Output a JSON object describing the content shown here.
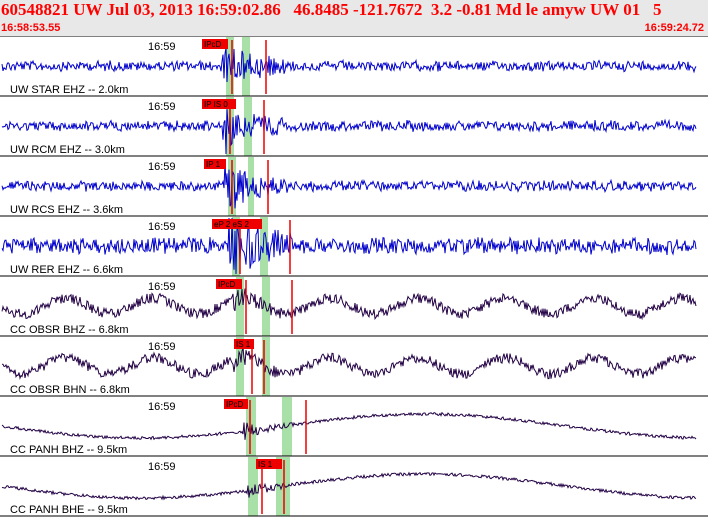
{
  "header": {
    "title": "60548821 UW Jul 03, 2013 16:59:02.86   46.8485 -121.7672  3.2 -0.81 Md le amyw UW 01   5",
    "start_time": "16:58:53.55",
    "end_time": "16:59:24.72"
  },
  "colors": {
    "header_text": "#ff0000",
    "header_bg": "#e8e8e8",
    "short_period_trace": "#0000cc",
    "broadband_trace": "#220044",
    "pick_band": "#a8e0a8",
    "pick_marker": "#ee0000"
  },
  "tracks": [
    {
      "time": "16:59",
      "label": "UW STAR EHZ -- 2.0km",
      "pick": "IPcD",
      "kind": "sp"
    },
    {
      "time": "16:59",
      "label": "UW RCM EHZ -- 3.0km",
      "pick": "IP IS 0",
      "kind": "sp"
    },
    {
      "time": "16:59",
      "label": "UW RCS EHZ -- 3.6km",
      "pick": "IP 1",
      "kind": "sp"
    },
    {
      "time": "16:59",
      "label": "UW RER EHZ -- 6.6km",
      "pick": "eP 2 eS 2",
      "kind": "sp"
    },
    {
      "time": "16:59",
      "label": "CC OBSR BHZ -- 6.8km",
      "pick": "IPcD",
      "kind": "bb"
    },
    {
      "time": "16:59",
      "label": "CC OBSR BHN -- 6.8km",
      "pick": "IS 1",
      "kind": "bb"
    },
    {
      "time": "16:59",
      "label": "CC PANH BHZ -- 9.5km",
      "pick": "IPcD",
      "kind": "bb"
    },
    {
      "time": "16:59",
      "label": "CC PANH BHE -- 9.5km",
      "pick": "IS 1",
      "kind": "bb"
    }
  ]
}
